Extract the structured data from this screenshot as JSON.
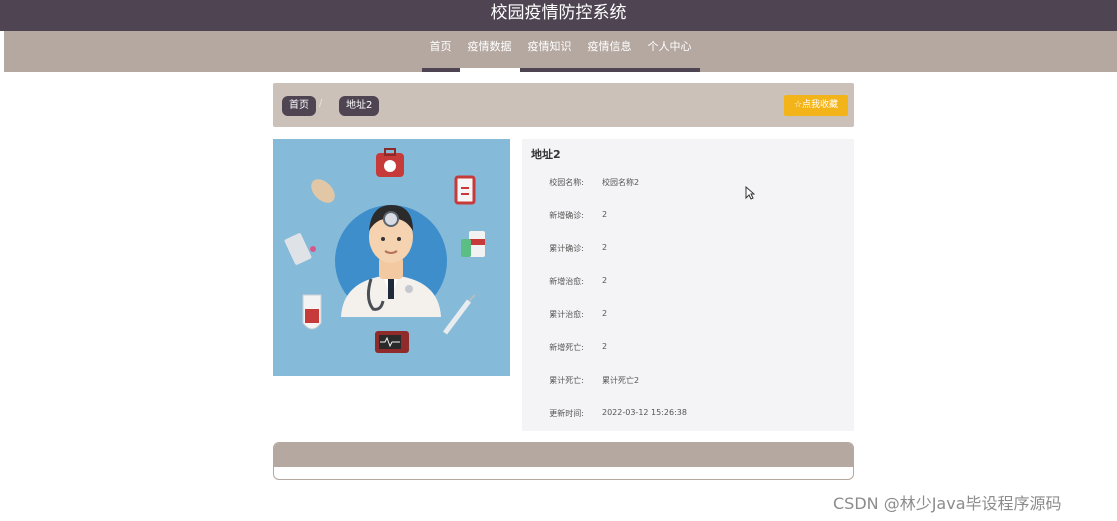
{
  "app": {
    "title": "校园疫情防控系统"
  },
  "nav": {
    "items": [
      {
        "label": "首页"
      },
      {
        "label": "疫情数据"
      },
      {
        "label": "疫情知识"
      },
      {
        "label": "疫情信息"
      },
      {
        "label": "个人中心"
      }
    ]
  },
  "breadcrumb": {
    "home": "首页",
    "separator": "/",
    "current": "地址2"
  },
  "actions": {
    "favorite_label": "☆点我收藏"
  },
  "detail": {
    "title": "地址2",
    "fields": [
      {
        "label": "校园名称:",
        "value": "校园名称2"
      },
      {
        "label": "新增确诊:",
        "value": "2"
      },
      {
        "label": "累计确诊:",
        "value": "2"
      },
      {
        "label": "新增治愈:",
        "value": "2"
      },
      {
        "label": "累计治愈:",
        "value": "2"
      },
      {
        "label": "新增死亡:",
        "value": "2"
      },
      {
        "label": "累计死亡:",
        "value": "累计死亡2"
      },
      {
        "label": "更新时间:",
        "value": "2022-03-12 15:26:38"
      }
    ]
  },
  "watermark": "CSDN @林少Java毕设程序源码",
  "colors": {
    "header": "#4e4452",
    "nav": "#b5a8a1",
    "accent": "#f3b41a",
    "image_bg": "#86bad9"
  }
}
